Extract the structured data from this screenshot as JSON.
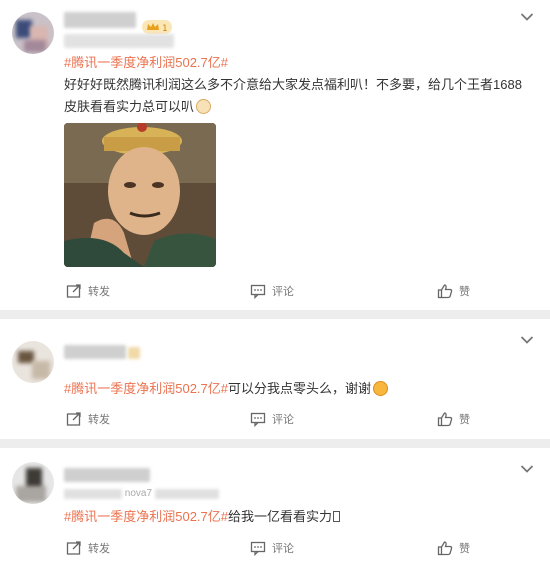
{
  "posts": [
    {
      "topic": "#腾讯一季度净利润502.7亿#",
      "text": "好好好既然腾讯利润这么多不介意给大家发点福利叭！不多要，给几个王者1688皮肤看看实力总可以叭",
      "actions": {
        "repost": "转发",
        "comment": "评论",
        "like": "赞"
      }
    },
    {
      "topic": "#腾讯一季度净利润502.7亿#",
      "text": "可以分我点零头么，谢谢",
      "actions": {
        "repost": "转发",
        "comment": "评论",
        "like": "赞"
      }
    },
    {
      "meta_partial": "nova7",
      "topic": "#腾讯一季度净利润502.7亿#",
      "text": "给我一亿看看实力",
      "actions": {
        "repost": "转发",
        "comment": "评论",
        "like": "赞"
      }
    }
  ],
  "colors": {
    "topic": "#eb7350",
    "page_bg": "#ededed",
    "card_bg": "#ffffff"
  },
  "icons": [
    "chevron-down-icon",
    "repost-icon",
    "comment-icon",
    "like-icon",
    "crown-badge-icon"
  ]
}
